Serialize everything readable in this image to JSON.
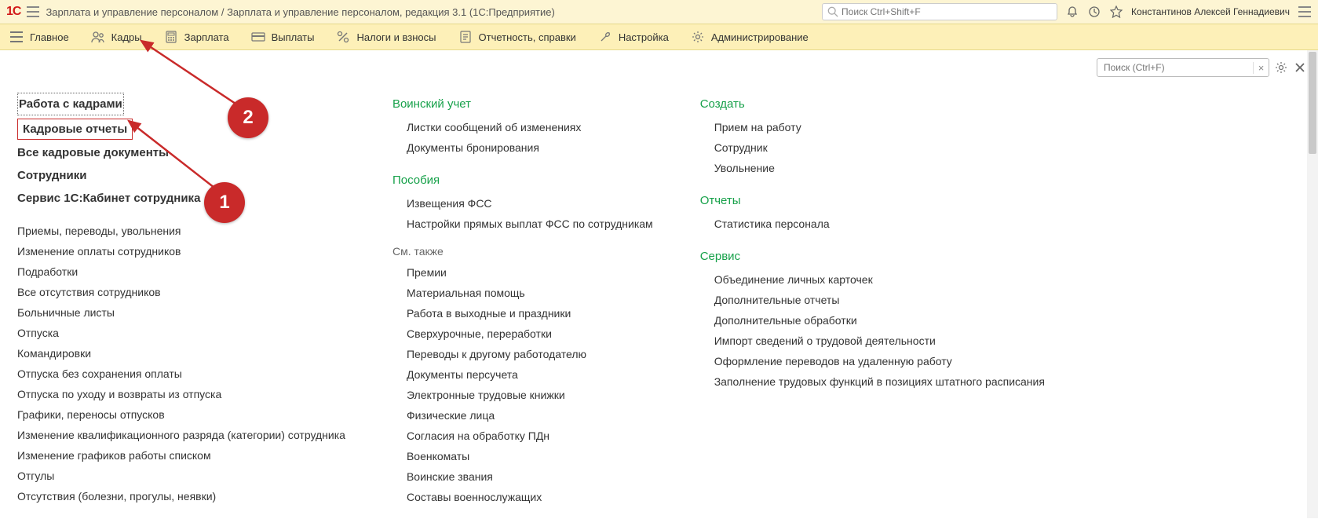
{
  "header": {
    "app_title": "Зарплата и управление персоналом / Зарплата и управление персоналом, редакция 3.1  (1С:Предприятие)",
    "search_placeholder": "Поиск Ctrl+Shift+F",
    "user_name": "Константинов Алексей Геннадиевич"
  },
  "nav": [
    {
      "label": "Главное"
    },
    {
      "label": "Кадры"
    },
    {
      "label": "Зарплата"
    },
    {
      "label": "Выплаты"
    },
    {
      "label": "Налоги и взносы"
    },
    {
      "label": "Отчетность, справки"
    },
    {
      "label": "Настройка"
    },
    {
      "label": "Администрирование"
    }
  ],
  "page_search": {
    "placeholder": "Поиск (Ctrl+F)"
  },
  "callouts": {
    "one": "1",
    "two": "2"
  },
  "col1": {
    "main": [
      "Работа с кадрами",
      "Кадровые отчеты",
      "Все кадровые документы",
      "Сотрудники",
      "Сервис 1С:Кабинет сотрудника"
    ],
    "links": [
      "Приемы, переводы, увольнения",
      "Изменение оплаты сотрудников",
      "Подработки",
      "Все отсутствия сотрудников",
      "Больничные листы",
      "Отпуска",
      "Командировки",
      "Отпуска без сохранения оплаты",
      "Отпуска по уходу и возвраты из отпуска",
      "Графики, переносы отпусков",
      "Изменение квалификационного разряда (категории) сотрудника",
      "Изменение графиков работы списком",
      "Отгулы",
      "Отсутствия (болезни, прогулы, неявки)"
    ]
  },
  "col2": {
    "sec1_title": "Воинский учет",
    "sec1_links": [
      "Листки сообщений об изменениях",
      "Документы бронирования"
    ],
    "sec2_title": "Пособия",
    "sec2_links": [
      "Извещения ФСС",
      "Настройки прямых выплат ФСС по сотрудникам"
    ],
    "sec3_title": "См. также",
    "sec3_links": [
      "Премии",
      "Материальная помощь",
      "Работа в выходные и праздники",
      "Сверхурочные, переработки",
      "Переводы к другому работодателю",
      "Документы персучета",
      "Электронные трудовые книжки",
      "Физические лица",
      "Согласия на обработку ПДн",
      "Военкоматы",
      "Воинские звания",
      "Составы военнослужащих"
    ]
  },
  "col3": {
    "sec1_title": "Создать",
    "sec1_links": [
      "Прием на работу",
      "Сотрудник",
      "Увольнение"
    ],
    "sec2_title": "Отчеты",
    "sec2_links": [
      "Статистика персонала"
    ],
    "sec3_title": "Сервис",
    "sec3_links": [
      "Объединение личных карточек",
      "Дополнительные отчеты",
      "Дополнительные обработки",
      "Импорт сведений о трудовой деятельности",
      "Оформление переводов на удаленную работу",
      "Заполнение трудовых функций в позициях штатного расписания"
    ]
  }
}
